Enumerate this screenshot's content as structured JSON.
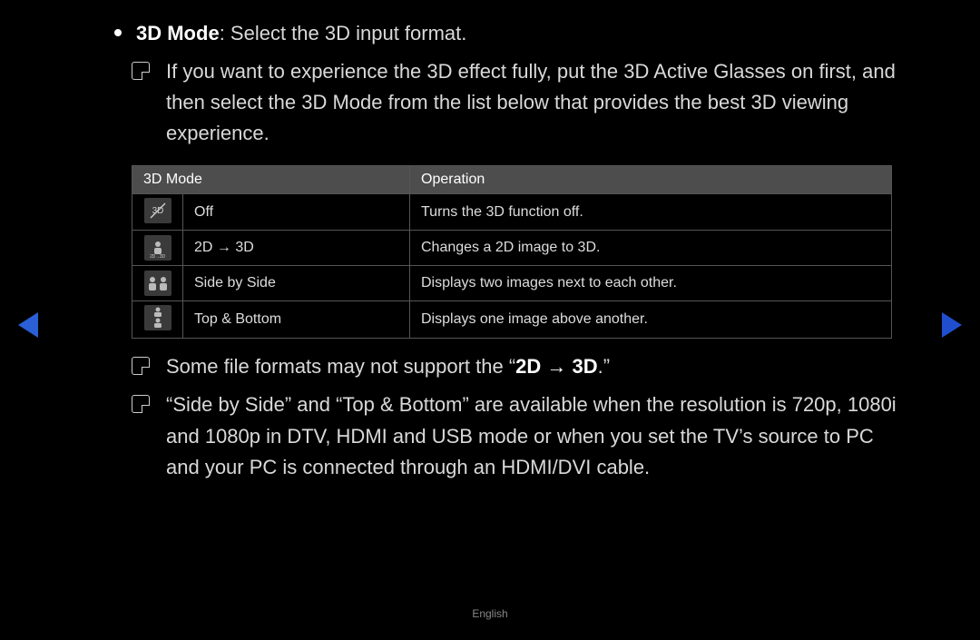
{
  "intro": {
    "label": "3D Mode",
    "desc": ": Select the 3D input format."
  },
  "notes": {
    "a": "If you want to experience the 3D effect fully, put the 3D Active Glasses on first, and then select the 3D Mode from the list below that provides the best 3D viewing experience.",
    "b_prefix": "Some file formats may not support the “",
    "b_bold": "2D → 3D",
    "b_suffix": ".”",
    "c": "“Side by Side” and “Top & Bottom” are available when the resolution is 720p, 1080i and 1080p in DTV, HDMI and USB mode or when you set the TV’s source to PC and your PC is connected through an HDMI/DVI cable."
  },
  "table": {
    "head_mode": "3D Mode",
    "head_op": "Operation",
    "rows": [
      {
        "icon": "off",
        "mode": "Off",
        "op": "Turns the 3D function off."
      },
      {
        "icon": "2d3d",
        "mode": "2D → 3D",
        "op": "Changes a 2D image to 3D."
      },
      {
        "icon": "sbs",
        "mode": "Side by Side",
        "op": "Displays two images next to each other."
      },
      {
        "icon": "tb",
        "mode": "Top & Bottom",
        "op": "Displays one image above another."
      }
    ]
  },
  "footer": "English"
}
